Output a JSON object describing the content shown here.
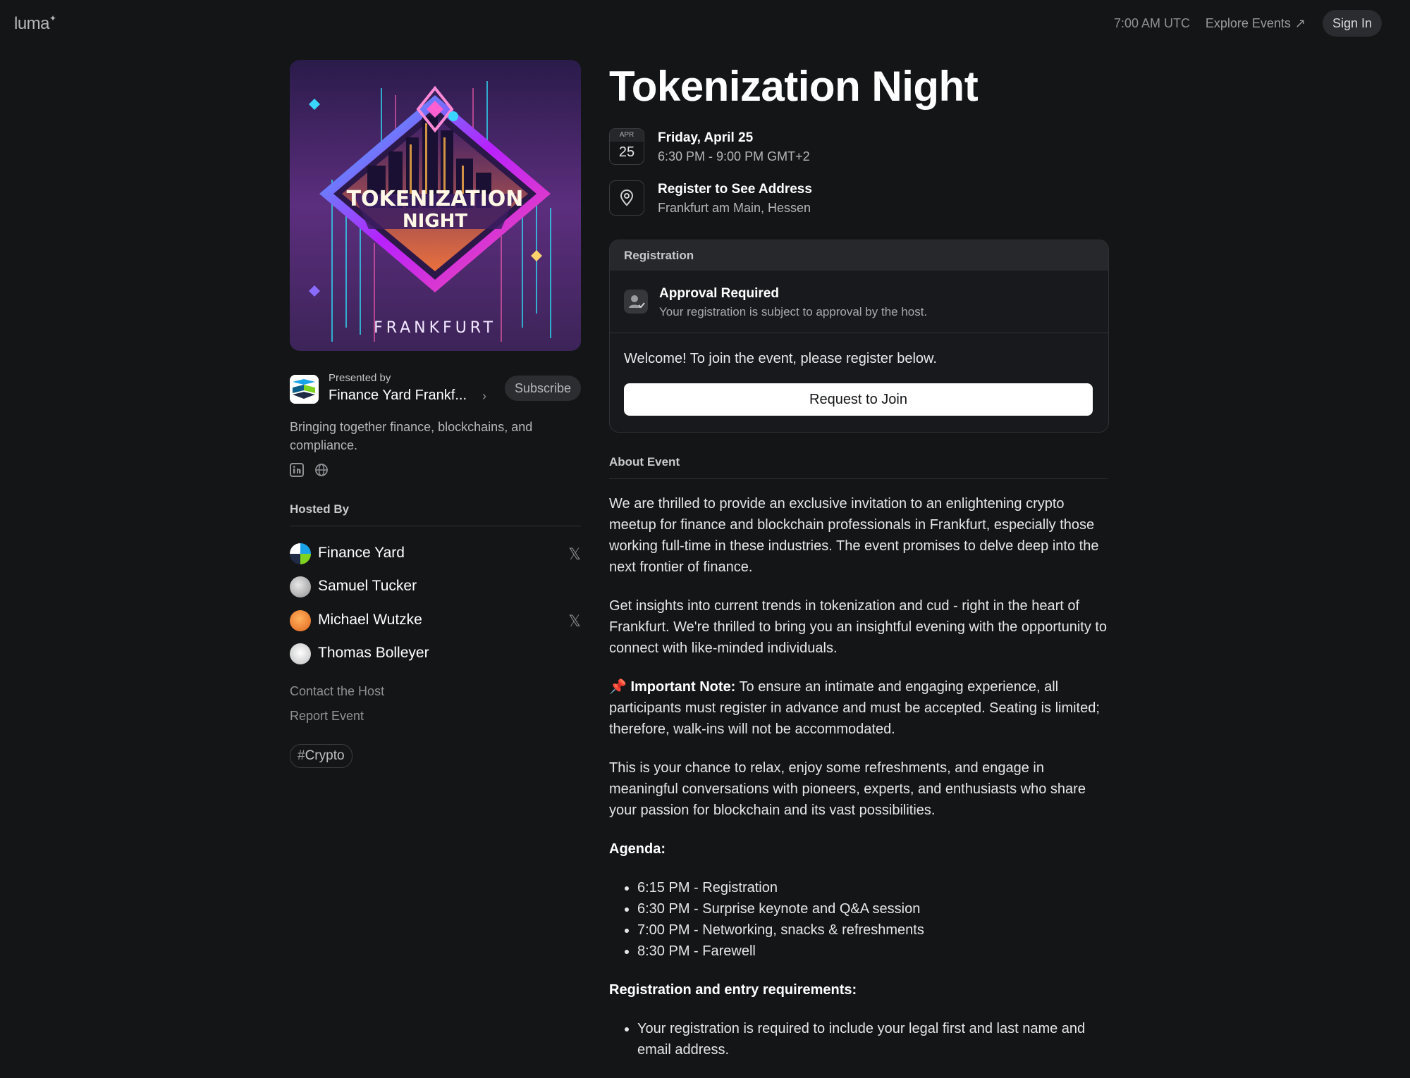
{
  "nav": {
    "logo": "luma",
    "time": "7:00 AM UTC",
    "explore": "Explore Events",
    "explore_icon": "arrow-up-right-icon",
    "signin": "Sign In"
  },
  "cover": {
    "headline_line1": "TOKENIZATION",
    "headline_line2": "NIGHT",
    "city": "FRANKFURT"
  },
  "presenter": {
    "label": "Presented by",
    "name": "Finance Yard Frankf...",
    "subscribe": "Subscribe",
    "description": "Bringing together finance, blockchains, and compliance.",
    "links": [
      "linkedin-icon",
      "globe-icon"
    ]
  },
  "hosts": {
    "title": "Hosted By",
    "items": [
      {
        "name": "Finance Yard",
        "has_x": true
      },
      {
        "name": "Samuel Tucker",
        "has_x": false
      },
      {
        "name": "Michael Wutzke",
        "has_x": true
      },
      {
        "name": "Thomas Bolleyer",
        "has_x": false
      }
    ],
    "x_glyph": "𝕏",
    "contact": "Contact the Host",
    "report": "Report Event",
    "tag": "Crypto"
  },
  "event": {
    "title": "Tokenization Night",
    "month": "APR",
    "day": "25",
    "date": "Friday, April 25",
    "time": "6:30 PM - 9:00 PM GMT+2",
    "location_title": "Register to See Address",
    "location_sub": "Frankfurt am Main, Hessen"
  },
  "registration": {
    "header": "Registration",
    "approval_title": "Approval Required",
    "approval_sub": "Your registration is subject to approval by the host.",
    "welcome": "Welcome! To join the event, please register below.",
    "button": "Request to Join"
  },
  "about": {
    "title": "About Event",
    "p1": "We are thrilled to provide an exclusive invitation to an enlightening crypto meetup for finance and blockchain professionals in Frankfurt, especially those working full-time in these industries. The event promises to delve deep into the next frontier of finance.",
    "p2": "Get insights into current trends in tokenization and cud - right in the heart of Frankfurt. We're thrilled to bring you an insightful evening with the opportunity to connect with like-minded individuals.",
    "note_emoji": "📌",
    "note_label": "Important Note:",
    "note_text": " To ensure an intimate and engaging experience, all participants must register in advance and must be accepted. Seating is limited; therefore, walk-ins will not be accommodated.",
    "p4": "This is your chance to relax, enjoy some refreshments, and engage in meaningful conversations with pioneers, experts, and enthusiasts who share your passion for blockchain and its vast possibilities.",
    "agenda_title": "Agenda:",
    "agenda": [
      "6:15 PM - Registration",
      "6:30 PM - Surprise keynote and Q&A session",
      "7:00 PM - Networking, snacks & refreshments",
      "8:30 PM - Farewell"
    ],
    "req_title": "Registration and entry requirements:",
    "requirements": [
      "Your registration is required to include your legal first and last name and email address."
    ]
  }
}
